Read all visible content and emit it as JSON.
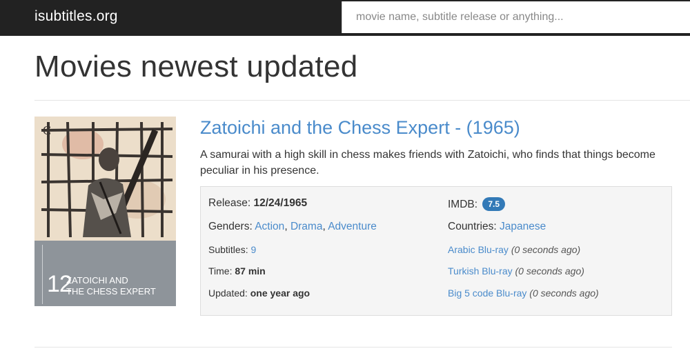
{
  "header": {
    "brand": "isubtitles.org",
    "search_placeholder": "movie name, subtitle release or anything..."
  },
  "page_title": "Movies newest updated",
  "movie": {
    "title": "Zatoichi and the Chess Expert - (1965)",
    "description": "A samurai with a high skill in chess makes friends with Zatoichi, who finds that things become peculiar in his presence.",
    "poster": {
      "number": "12",
      "title": "ZATOICHI AND\nTHE CHESS EXPERT"
    },
    "release_label": "Release:",
    "release_value": "12/24/1965",
    "imdb_label": "IMDB:",
    "imdb_value": "7.5",
    "genres_label": "Genders:",
    "genres": [
      "Action",
      "Drama",
      "Adventure"
    ],
    "countries_label": "Countries:",
    "country": "Japanese",
    "subtitles_label": "Subtitles:",
    "subtitles_count": "9",
    "time_label": "Time:",
    "time_value": "87 min",
    "updated_label": "Updated:",
    "updated_value": "one year ago",
    "subtitle_releases": [
      {
        "name": "Arabic Blu-ray",
        "ago": "(0 seconds ago)"
      },
      {
        "name": "Turkish Blu-ray",
        "ago": "(0 seconds ago)"
      },
      {
        "name": "Big 5 code Blu-ray",
        "ago": "(0 seconds ago)"
      }
    ]
  },
  "colors": {
    "navbar": "#222222",
    "link": "#4a8bcb",
    "badge": "#337ab7",
    "info_bg": "#f5f5f5"
  }
}
